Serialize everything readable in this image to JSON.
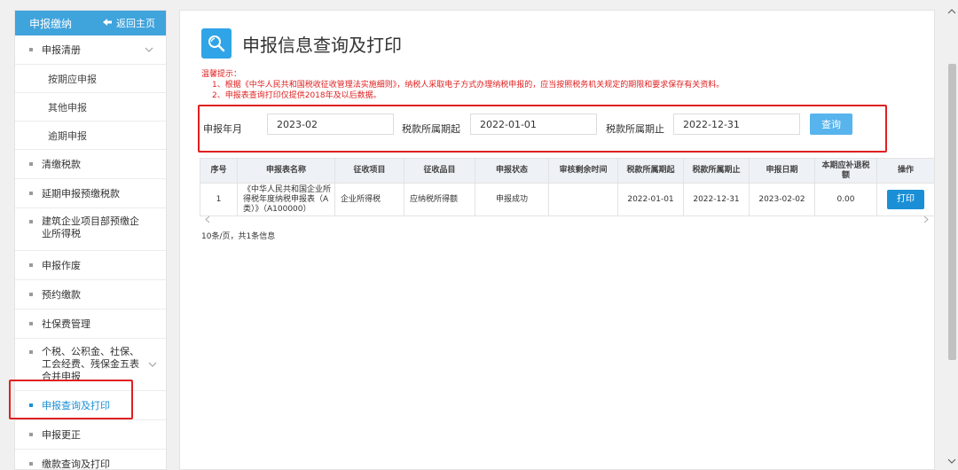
{
  "sidebar": {
    "title": "申报缴纳",
    "back_label": "返回主页",
    "items": [
      {
        "label": "申报清册"
      },
      {
        "label": "按期应申报"
      },
      {
        "label": "其他申报"
      },
      {
        "label": "逾期申报"
      },
      {
        "label": "清缴税款"
      },
      {
        "label": "延期申报预缴税款"
      },
      {
        "label": "建筑企业项目部预缴企业所得税"
      },
      {
        "label": "申报作废"
      },
      {
        "label": "预约缴款"
      },
      {
        "label": "社保费管理"
      },
      {
        "label": "个税、公积金、社保、工会经费、残保金五表合并申报"
      },
      {
        "label": "申报查询及打印"
      },
      {
        "label": "申报更正"
      },
      {
        "label": "缴款查询及打印"
      }
    ]
  },
  "page": {
    "title": "申报信息查询及打印"
  },
  "tips": {
    "heading": "温馨提示：",
    "lines": [
      "1、根据《中华人民共和国税收征收管理法实施细则》，纳税人采取电子方式办理纳税申报的，应当按照税务机关规定的期限和要求保存有关资料。",
      "2、申报表查询打印仅提供2018年及以后数据。"
    ]
  },
  "search": {
    "year_month_label": "申报年月",
    "year_month_value": "2023-02",
    "period_start_label": "税款所属期起",
    "period_start_value": "2022-01-01",
    "period_end_label": "税款所属期止",
    "period_end_value": "2022-12-31",
    "query_button": "查询"
  },
  "table": {
    "headers": [
      "序号",
      "申报表名称",
      "征收项目",
      "征收品目",
      "申报状态",
      "审核剩余时间",
      "税款所属期起",
      "税款所属期止",
      "申报日期",
      "本期应补退税额",
      "操作"
    ],
    "rows": [
      {
        "index": "1",
        "name": "《中华人民共和国企业所得税年度纳税申报表（A类）》（A100000）",
        "item": "企业所得税",
        "sub_item": "应纳税所得额",
        "status": "申报成功",
        "remaining": "",
        "start": "2022-01-01",
        "end": "2022-12-31",
        "date": "2023-02-02",
        "amount": "0.00",
        "action": "打印"
      }
    ]
  },
  "pager": {
    "text": "10条/页，共1条信息"
  },
  "colors": {
    "accent": "#3fa3dc",
    "highlight_box": "#e02020",
    "button": "#1a8fd6"
  }
}
